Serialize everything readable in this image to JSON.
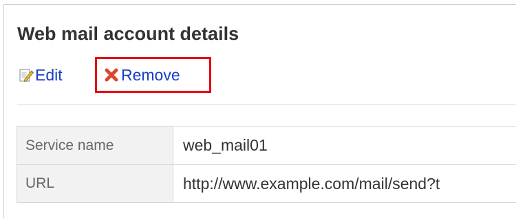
{
  "page": {
    "title": "Web mail account details"
  },
  "actions": {
    "edit_label": "Edit",
    "remove_label": "Remove"
  },
  "details": [
    {
      "label": "Service name",
      "value": "web_mail01"
    },
    {
      "label": "URL",
      "value": "http://www.example.com/mail/send?t"
    }
  ],
  "colors": {
    "link": "#1a3ec8",
    "highlight_border": "#e60012",
    "label_bg": "#f2f2f2",
    "remove_icon": "#d9482b"
  },
  "icons": {
    "edit": "edit-icon",
    "remove": "remove-icon"
  }
}
